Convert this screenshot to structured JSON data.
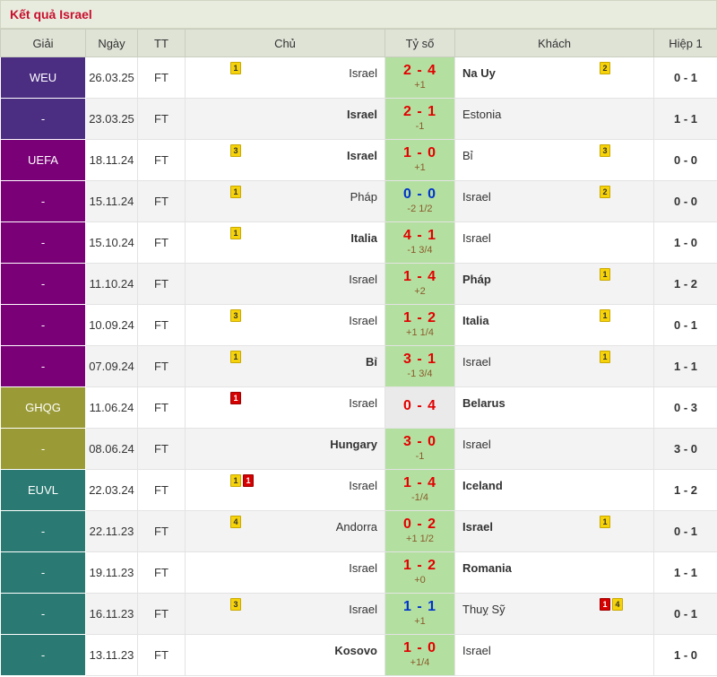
{
  "title": "Kết quả Israel",
  "headers": {
    "league": "Giải",
    "date": "Ngày",
    "status": "TT",
    "home": "Chủ",
    "score": "Tỷ số",
    "away": "Khách",
    "halftime": "Hiệp 1"
  },
  "colors": {
    "WEU": "#4b2d82",
    "UEFA": "#7a0077",
    "GHQG": "#9a9a36",
    "EUVL": "#2a7a73",
    "score_green": "#b3e0a0",
    "score_grey": "#eaeaea"
  },
  "rows": [
    {
      "league": "WEU",
      "date": "26.03.25",
      "status": "FT",
      "home": "Israel",
      "home_bold": false,
      "home_badges": [
        {
          "type": "yellow",
          "n": "1"
        }
      ],
      "score": "2 - 4",
      "score_color": "red",
      "handicap": "+1",
      "away": "Na Uy",
      "away_bold": true,
      "away_badges": [
        {
          "type": "yellow",
          "n": "2"
        }
      ],
      "ht": "0 - 1",
      "bg": "WEU",
      "grey": false
    },
    {
      "league": "-",
      "date": "23.03.25",
      "status": "FT",
      "home": "Israel",
      "home_bold": true,
      "home_badges": [],
      "score": "2 - 1",
      "score_color": "red",
      "handicap": "-1",
      "away": "Estonia",
      "away_bold": false,
      "away_badges": [],
      "ht": "1 - 1",
      "bg": "WEU",
      "grey": false
    },
    {
      "league": "UEFA",
      "date": "18.11.24",
      "status": "FT",
      "home": "Israel",
      "home_bold": true,
      "home_badges": [
        {
          "type": "yellow",
          "n": "3"
        }
      ],
      "score": "1 - 0",
      "score_color": "red",
      "handicap": "+1",
      "away": "Bỉ",
      "away_bold": false,
      "away_badges": [
        {
          "type": "yellow",
          "n": "3"
        }
      ],
      "ht": "0 - 0",
      "bg": "UEFA",
      "grey": false
    },
    {
      "league": "-",
      "date": "15.11.24",
      "status": "FT",
      "home": "Pháp",
      "home_bold": false,
      "home_badges": [
        {
          "type": "yellow",
          "n": "1"
        }
      ],
      "score": "0 - 0",
      "score_color": "blue",
      "handicap": "-2 1/2",
      "away": "Israel",
      "away_bold": false,
      "away_badges": [
        {
          "type": "yellow",
          "n": "2"
        }
      ],
      "ht": "0 - 0",
      "bg": "UEFA",
      "grey": false
    },
    {
      "league": "-",
      "date": "15.10.24",
      "status": "FT",
      "home": "Italia",
      "home_bold": true,
      "home_badges": [
        {
          "type": "yellow",
          "n": "1"
        }
      ],
      "score": "4 - 1",
      "score_color": "red",
      "handicap": "-1 3/4",
      "away": "Israel",
      "away_bold": false,
      "away_badges": [],
      "ht": "1 - 0",
      "bg": "UEFA",
      "grey": false
    },
    {
      "league": "-",
      "date": "11.10.24",
      "status": "FT",
      "home": "Israel",
      "home_bold": false,
      "home_badges": [],
      "score": "1 - 4",
      "score_color": "red",
      "handicap": "+2",
      "away": "Pháp",
      "away_bold": true,
      "away_badges": [
        {
          "type": "yellow",
          "n": "1"
        }
      ],
      "ht": "1 - 2",
      "bg": "UEFA",
      "grey": false
    },
    {
      "league": "-",
      "date": "10.09.24",
      "status": "FT",
      "home": "Israel",
      "home_bold": false,
      "home_badges": [
        {
          "type": "yellow",
          "n": "3"
        }
      ],
      "score": "1 - 2",
      "score_color": "red",
      "handicap": "+1 1/4",
      "away": "Italia",
      "away_bold": true,
      "away_badges": [
        {
          "type": "yellow",
          "n": "1"
        }
      ],
      "ht": "0 - 1",
      "bg": "UEFA",
      "grey": false
    },
    {
      "league": "-",
      "date": "07.09.24",
      "status": "FT",
      "home": "Bỉ",
      "home_bold": true,
      "home_badges": [
        {
          "type": "yellow",
          "n": "1"
        }
      ],
      "score": "3 - 1",
      "score_color": "red",
      "handicap": "-1 3/4",
      "away": "Israel",
      "away_bold": false,
      "away_badges": [
        {
          "type": "yellow",
          "n": "1"
        }
      ],
      "ht": "1 - 1",
      "bg": "UEFA",
      "grey": false
    },
    {
      "league": "GHQG",
      "date": "11.06.24",
      "status": "FT",
      "home": "Israel",
      "home_bold": false,
      "home_badges": [
        {
          "type": "red",
          "n": "1"
        }
      ],
      "score": "0 - 4",
      "score_color": "red",
      "handicap": "",
      "away": "Belarus",
      "away_bold": true,
      "away_badges": [],
      "ht": "0 - 3",
      "bg": "GHQG",
      "grey": true
    },
    {
      "league": "-",
      "date": "08.06.24",
      "status": "FT",
      "home": "Hungary",
      "home_bold": true,
      "home_badges": [],
      "score": "3 - 0",
      "score_color": "red",
      "handicap": "-1",
      "away": "Israel",
      "away_bold": false,
      "away_badges": [],
      "ht": "3 - 0",
      "bg": "GHQG",
      "grey": false
    },
    {
      "league": "EUVL",
      "date": "22.03.24",
      "status": "FT",
      "home": "Israel",
      "home_bold": false,
      "home_badges": [
        {
          "type": "yellow",
          "n": "1"
        },
        {
          "type": "red",
          "n": "1"
        }
      ],
      "score": "1 - 4",
      "score_color": "red",
      "handicap": "-1/4",
      "away": "Iceland",
      "away_bold": true,
      "away_badges": [],
      "ht": "1 - 2",
      "bg": "EUVL",
      "grey": false
    },
    {
      "league": "-",
      "date": "22.11.23",
      "status": "FT",
      "home": "Andorra",
      "home_bold": false,
      "home_badges": [
        {
          "type": "yellow",
          "n": "4"
        }
      ],
      "score": "0 - 2",
      "score_color": "red",
      "handicap": "+1 1/2",
      "away": "Israel",
      "away_bold": true,
      "away_badges": [
        {
          "type": "yellow",
          "n": "1"
        }
      ],
      "ht": "0 - 1",
      "bg": "EUVL",
      "grey": false
    },
    {
      "league": "-",
      "date": "19.11.23",
      "status": "FT",
      "home": "Israel",
      "home_bold": false,
      "home_badges": [],
      "score": "1 - 2",
      "score_color": "red",
      "handicap": "+0",
      "away": "Romania",
      "away_bold": true,
      "away_badges": [],
      "ht": "1 - 1",
      "bg": "EUVL",
      "grey": false
    },
    {
      "league": "-",
      "date": "16.11.23",
      "status": "FT",
      "home": "Israel",
      "home_bold": false,
      "home_badges": [
        {
          "type": "yellow",
          "n": "3"
        }
      ],
      "score": "1 - 1",
      "score_color": "blue",
      "handicap": "+1",
      "away": "Thuỵ Sỹ",
      "away_bold": false,
      "away_badges": [
        {
          "type": "red",
          "n": "1"
        },
        {
          "type": "yellow",
          "n": "4"
        }
      ],
      "ht": "0 - 1",
      "bg": "EUVL",
      "grey": false
    },
    {
      "league": "-",
      "date": "13.11.23",
      "status": "FT",
      "home": "Kosovo",
      "home_bold": true,
      "home_badges": [],
      "score": "1 - 0",
      "score_color": "red",
      "handicap": "+1/4",
      "away": "Israel",
      "away_bold": false,
      "away_badges": [],
      "ht": "1 - 0",
      "bg": "EUVL",
      "grey": false
    }
  ]
}
